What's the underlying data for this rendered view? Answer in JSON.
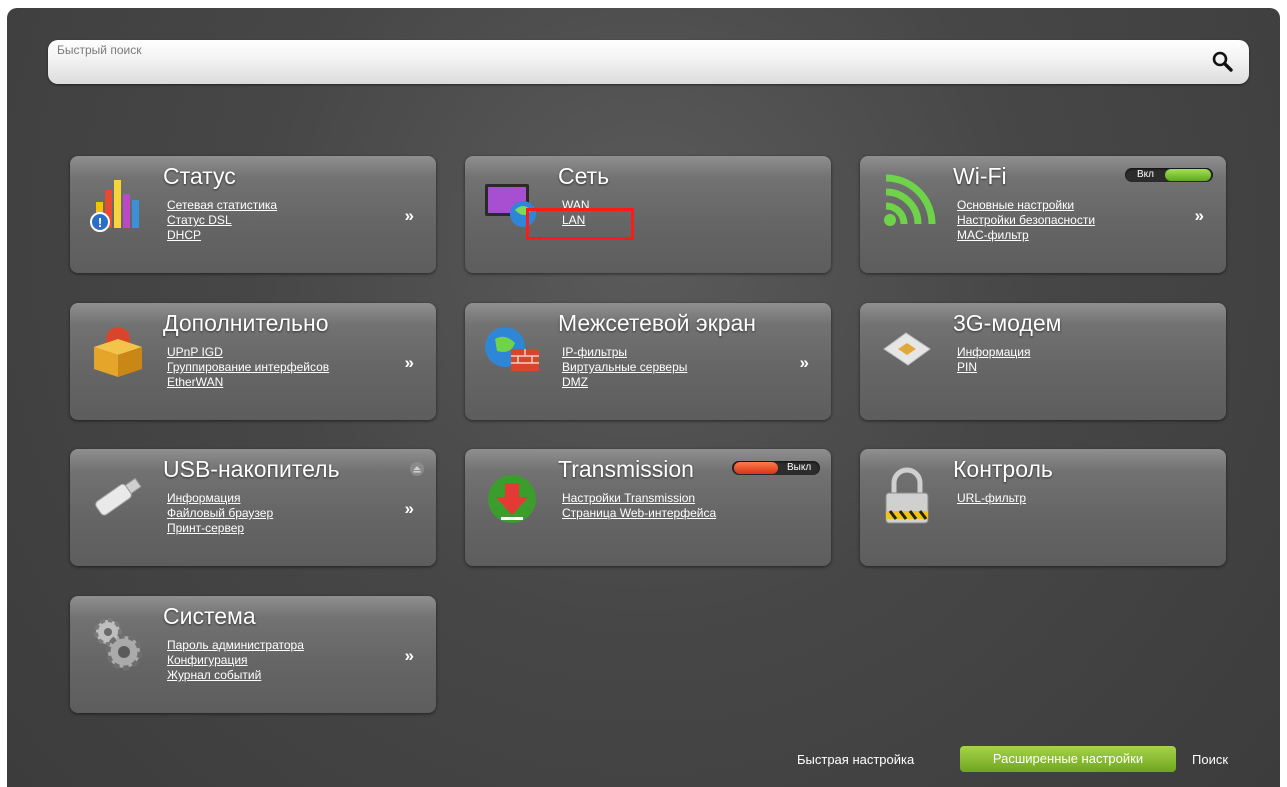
{
  "search": {
    "placeholder": "Быстрый поиск"
  },
  "cards": {
    "status": {
      "title": "Статус",
      "links": [
        "Сетевая статистика",
        "Статус DSL",
        "DHCP"
      ],
      "more": "»"
    },
    "network": {
      "title": "Сеть",
      "links": [
        "WAN",
        "LAN"
      ]
    },
    "wifi": {
      "title": "Wi-Fi",
      "toggle": "Вкл",
      "links": [
        "Основные настройки",
        "Настройки безопасности",
        "MAC-фильтр"
      ],
      "more": "»"
    },
    "advanced": {
      "title": "Дополнительно",
      "links": [
        "UPnP IGD",
        "Группирование интерфейсов",
        "EtherWAN"
      ],
      "more": "»"
    },
    "firewall": {
      "title": "Межсетевой экран",
      "links": [
        "IP-фильтры",
        "Виртуальные серверы",
        "DMZ"
      ],
      "more": "»"
    },
    "modem3g": {
      "title": "3G-модем",
      "links": [
        "Информация",
        "PIN"
      ]
    },
    "usb": {
      "title": "USB-накопитель",
      "links": [
        "Информация",
        "Файловый браузер",
        "Принт-сервер"
      ],
      "more": "»"
    },
    "transmission": {
      "title": "Transmission",
      "toggle": "Выкл",
      "links": [
        "Настройки Transmission",
        "Страница Web-интерфейса"
      ]
    },
    "control": {
      "title": "Контроль",
      "links": [
        "URL-фильтр"
      ]
    },
    "system": {
      "title": "Система",
      "links": [
        "Пароль администратора",
        "Конфигурация",
        "Журнал событий"
      ],
      "more": "»"
    }
  },
  "bottom": {
    "quick_setup": "Быстрая настройка",
    "advanced_settings": "Расширенные настройки",
    "search": "Поиск"
  },
  "colors": {
    "accent_green": "#8cc63f",
    "toggle_off": "#e64a19",
    "highlight": "#ff1a1a"
  },
  "icons": {
    "status": "bar-chart-icon",
    "network": "monitor-globe-icon",
    "wifi": "wifi-icon",
    "advanced": "box-icon",
    "firewall": "globe-firewall-icon",
    "modem3g": "sim-card-icon",
    "usb": "usb-stick-icon",
    "transmission": "download-arrow-icon",
    "control": "padlock-icon",
    "system": "gears-icon"
  }
}
